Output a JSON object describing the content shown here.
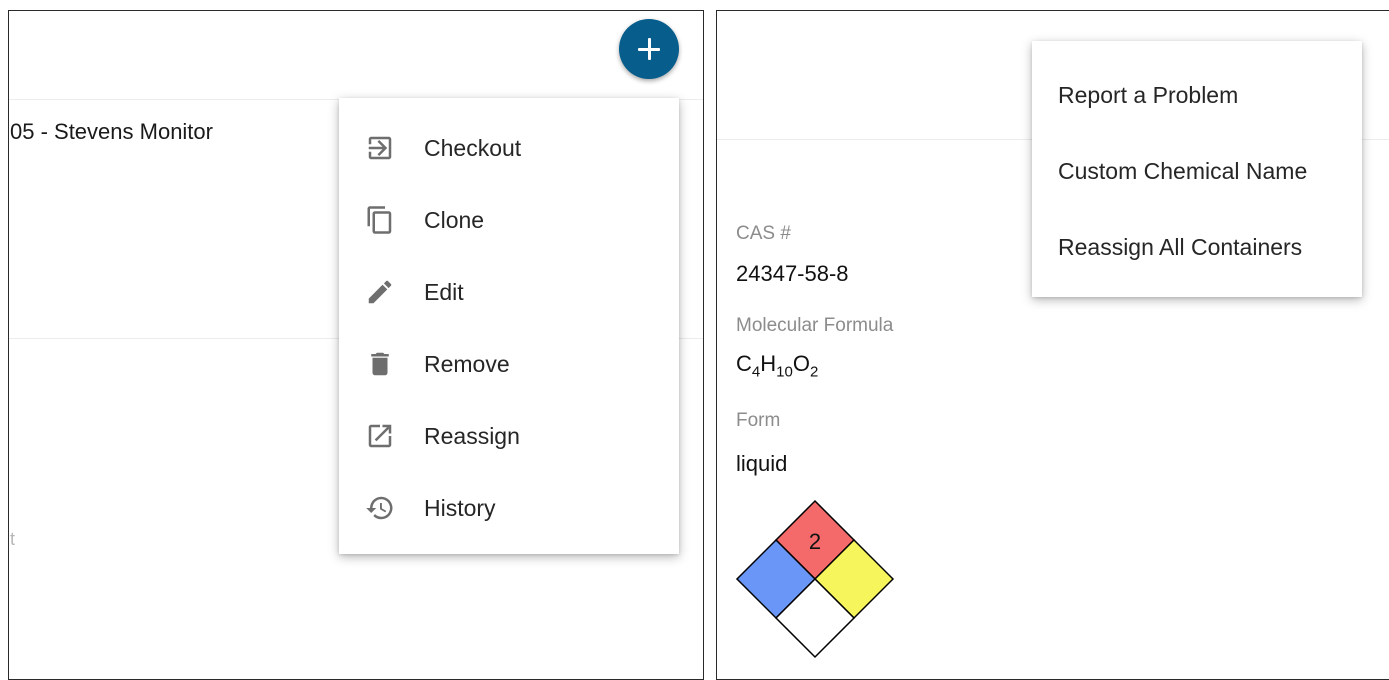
{
  "left": {
    "fab": {
      "icon": "plus-icon"
    },
    "row_title": "05 - Stevens Monitor",
    "faded_text": "t",
    "menu": [
      {
        "label": "Checkout",
        "icon": "login-arrow-icon"
      },
      {
        "label": "Clone",
        "icon": "copy-icon"
      },
      {
        "label": "Edit",
        "icon": "pencil-icon"
      },
      {
        "label": "Remove",
        "icon": "trash-icon"
      },
      {
        "label": "Reassign",
        "icon": "open-external-icon"
      },
      {
        "label": "History",
        "icon": "history-icon"
      }
    ]
  },
  "right": {
    "menu": [
      {
        "label": "Report a Problem"
      },
      {
        "label": "Custom Chemical Name"
      },
      {
        "label": "Reassign All Containers"
      }
    ],
    "fields": {
      "cas_label": "CAS #",
      "cas_value": "24347-58-8",
      "formula_label": "Molecular Formula",
      "formula_value": "C4H10O2",
      "form_label": "Form",
      "form_value": "liquid"
    },
    "nfpa": {
      "health": "",
      "flammability": "2",
      "instability": "",
      "special": "",
      "colors": {
        "health": "#6a96f7",
        "flammability": "#f46a6a",
        "instability": "#f6f65c",
        "special": "#ffffff"
      }
    }
  },
  "colors": {
    "fab": "#075d8c",
    "icon_gray": "#6e6e6e"
  }
}
